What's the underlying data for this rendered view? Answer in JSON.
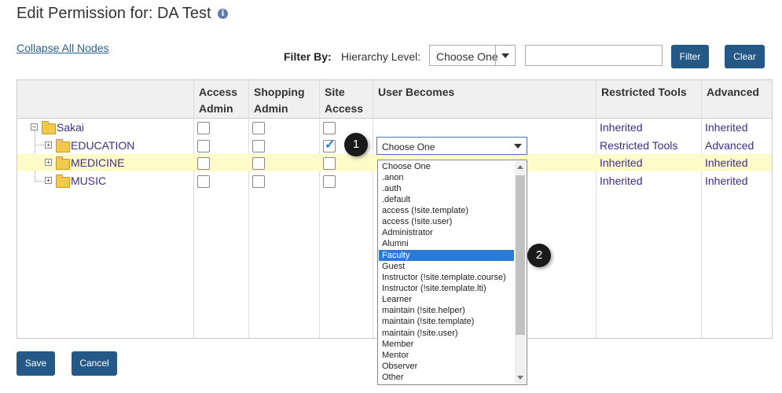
{
  "page": {
    "title": "Edit Permission for: DA Test",
    "info_icon": "info-icon",
    "collapse_link": "Collapse All Nodes"
  },
  "filter": {
    "label": "Filter By:",
    "hierarchy_label": "Hierarchy Level:",
    "select_value": "Choose One",
    "input_value": "",
    "filter_button": "Filter",
    "clear_button": "Clear"
  },
  "table": {
    "headers": {
      "access_admin": [
        "Access",
        "Admin"
      ],
      "shopping_admin": [
        "Shopping",
        "Admin"
      ],
      "site_access": [
        "Site",
        "Access"
      ],
      "user_becomes": "User Becomes",
      "restricted_tools": "Restricted Tools",
      "advanced": "Advanced"
    },
    "rows": [
      {
        "name": "Sakai",
        "access_admin": false,
        "shopping_admin": false,
        "site_access": false,
        "restricted": "Inherited",
        "advanced": "Inherited",
        "highlight": false
      },
      {
        "name": "EDUCATION",
        "access_admin": false,
        "shopping_admin": false,
        "site_access": true,
        "user_becomes": "Choose One",
        "restricted": "Restricted Tools",
        "advanced": "Advanced",
        "highlight": false
      },
      {
        "name": "MEDICINE",
        "access_admin": false,
        "shopping_admin": false,
        "site_access": false,
        "restricted": "Inherited",
        "advanced": "Inherited",
        "highlight": true
      },
      {
        "name": "MUSIC",
        "access_admin": false,
        "shopping_admin": false,
        "site_access": false,
        "restricted": "Inherited",
        "advanced": "Inherited",
        "highlight": false
      }
    ]
  },
  "dropdown": {
    "options": [
      "Choose One",
      ".anon",
      ".auth",
      ".default",
      "access (!site.template)",
      "access (!site.user)",
      "Administrator",
      "Alumni",
      "Faculty",
      "Guest",
      "Instructor (!site.template.course)",
      "Instructor (!site.template.lti)",
      "Learner",
      "maintain (!site.helper)",
      "maintain (!site.template)",
      "maintain (!site.user)",
      "Member",
      "Mentor",
      "Observer",
      "Other"
    ],
    "selected": "Faculty"
  },
  "callouts": [
    "1",
    "2"
  ],
  "actions": {
    "save": "Save",
    "cancel": "Cancel"
  },
  "colors": {
    "button": "#245886",
    "link": "#3f2c8c",
    "highlight_row": "#fdfbc8",
    "selected_option": "#2a7ad8"
  }
}
